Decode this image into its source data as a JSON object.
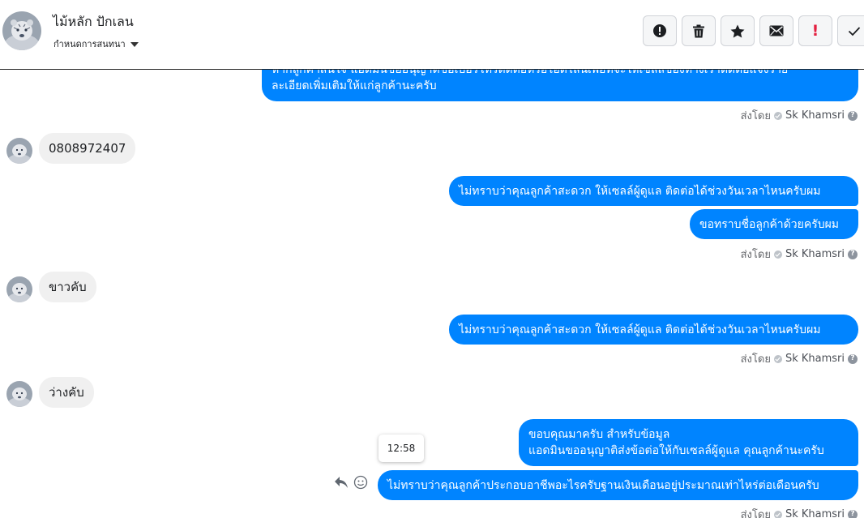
{
  "header": {
    "contact_name": "ไม้หลัก ปักเลน",
    "label_select": "กำหนดการสนทนา",
    "actions": [
      {
        "icon": "alert-circle-icon",
        "name": "report-button"
      },
      {
        "icon": "trash-icon",
        "name": "delete-button"
      },
      {
        "icon": "star-icon",
        "name": "star-button"
      },
      {
        "icon": "envelope-icon",
        "name": "mark-unread-button"
      },
      {
        "icon": "exclamation-icon",
        "name": "spam-button",
        "glyph": "!"
      },
      {
        "icon": "checkmark-icon",
        "name": "mark-done-button"
      }
    ]
  },
  "messages": {
    "m1_line1": "หากลูกค้าสนใจ แอดมินขออนุญาตขอเบอร์โทรติดต่อหรือไอดีไลน์เพื่อที่จะให้เซลล์ของทางเราติดต่อแจ้งราย",
    "m1_line2": "ละเอียดเพิ่มเติมให้แก่ลูกค้านะครับ",
    "sent_by_prefix": "ส่งโดย",
    "agent_name": "Sk Khamsri",
    "in_phone": "0808972407",
    "m2": "ไม่ทราบว่าคุณลูกค้าสะดวก ให้เซลล์ผู้ดูแล ติดต่อได้ช่วงวันเวลาไหนครับผม",
    "m3": "ขอทราบชื่อลูกค้าด้วยครับผม",
    "in_2": "ขาวคับ",
    "m4": "ไม่ทราบว่าคุณลูกค้าสะดวก ให้เซลล์ผู้ดูแล ติดต่อได้ช่วงวันเวลาไหนครับผม",
    "in_3": "ว่างคับ",
    "m5_line1": "ขอบคุณมาครับ สำหรับข้อมูล",
    "m5_line2": "แอดมินขออนุญาติส่งข้อต่อให้กับเซลล์ผู้ดูแล คุณลูกค้านะครับ",
    "m6": "ไม่ทราบว่าคุณลูกค้าประกอบอาชีพอะไรครับฐานเงินเดือนอยู่ประมาณเท่าไหร่ต่อเดือนครับ",
    "tooltip_time": "12:58"
  },
  "colors": {
    "outgoing_bubble": "#0084ff",
    "incoming_bubble": "#f0f0f0",
    "spam_icon": "#e41e3f"
  }
}
